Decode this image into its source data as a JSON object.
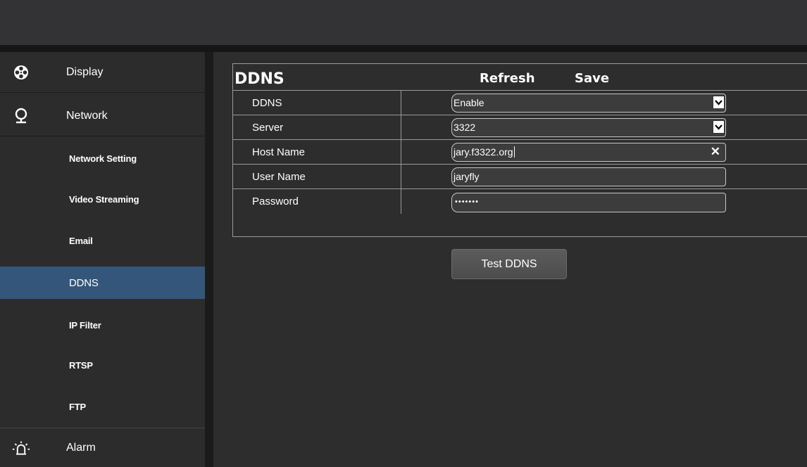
{
  "sidebar": {
    "main_items": [
      {
        "label": "Display",
        "icon": "film-reel-icon"
      },
      {
        "label": "Network",
        "icon": "globe-pin-icon"
      },
      {
        "label": "Alarm",
        "icon": "alarm-light-icon"
      }
    ],
    "sub_items": [
      {
        "label": "Network Setting"
      },
      {
        "label": "Video Streaming"
      },
      {
        "label": "Email"
      },
      {
        "label": "DDNS",
        "active": true
      },
      {
        "label": "IP Filter"
      },
      {
        "label": "RTSP"
      },
      {
        "label": "FTP"
      }
    ]
  },
  "form": {
    "title": "DDNS",
    "refresh_label": "Refresh",
    "save_label": "Save",
    "rows": [
      {
        "label": "DDNS",
        "type": "select",
        "value": "Enable"
      },
      {
        "label": "Server",
        "type": "select",
        "value": "3322"
      },
      {
        "label": "Host Name",
        "type": "text",
        "value": "jary.f3322.org",
        "clear_icon": "close-icon"
      },
      {
        "label": "User Name",
        "type": "text",
        "value": "jaryfly"
      },
      {
        "label": "Password",
        "type": "password",
        "value": "•••••••"
      }
    ]
  },
  "test_button_label": "Test DDNS",
  "colors": {
    "background": "#2b2b2b",
    "active_item": "#34567a",
    "border": "#9a9a9a"
  }
}
